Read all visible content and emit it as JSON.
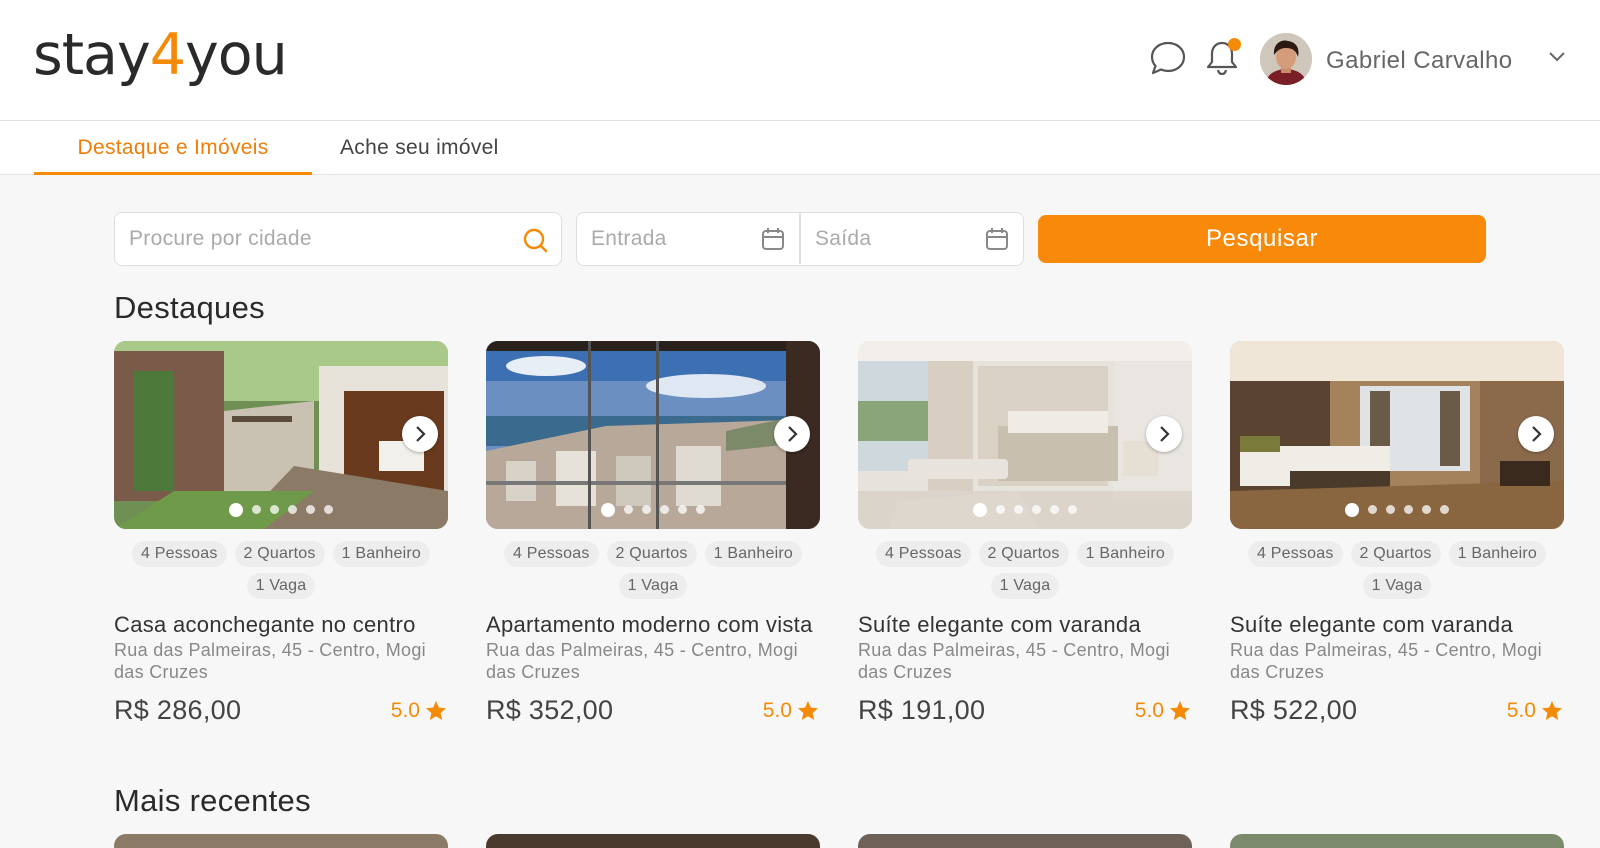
{
  "header": {
    "logo_prefix": "stay",
    "logo_four": "4",
    "logo_suffix": "you",
    "user_name": "Gabriel Carvalho"
  },
  "tabs": [
    {
      "label": "Destaque e Imóveis",
      "active": true
    },
    {
      "label": "Ache seu imóvel",
      "active": false
    }
  ],
  "search": {
    "city_placeholder": "Procure por cidade",
    "checkin_placeholder": "Entrada",
    "checkout_placeholder": "Saída",
    "button_label": "Pesquisar"
  },
  "sections": {
    "featured_title": "Destaques",
    "recent_title": "Mais recentes"
  },
  "colors": {
    "accent": "#f58a07"
  },
  "cards": [
    {
      "chips": [
        "4 Pessoas",
        "2 Quartos",
        "1 Banheiro",
        "1 Vaga"
      ],
      "title": "Casa aconchegante no centro",
      "address": "Rua das Palmeiras, 45 - Centro, Mogi das Cruzes",
      "price": "R$ 286,00",
      "rating": "5.0"
    },
    {
      "chips": [
        "4 Pessoas",
        "2 Quartos",
        "1 Banheiro",
        "1 Vaga"
      ],
      "title": "Apartamento moderno com vista",
      "address": "Rua das Palmeiras, 45 - Centro, Mogi das Cruzes",
      "price": "R$ 352,00",
      "rating": "5.0"
    },
    {
      "chips": [
        "4 Pessoas",
        "2 Quartos",
        "1 Banheiro",
        "1 Vaga"
      ],
      "title": "Suíte elegante com varanda",
      "address": "Rua das Palmeiras, 45 - Centro, Mogi das Cruzes",
      "price": "R$ 191,00",
      "rating": "5.0"
    },
    {
      "chips": [
        "4 Pessoas",
        "2 Quartos",
        "1 Banheiro",
        "1 Vaga"
      ],
      "title": "Suíte elegante com varanda",
      "address": "Rua das Palmeiras, 45 - Centro, Mogi das Cruzes",
      "price": "R$ 522,00",
      "rating": "5.0"
    }
  ]
}
